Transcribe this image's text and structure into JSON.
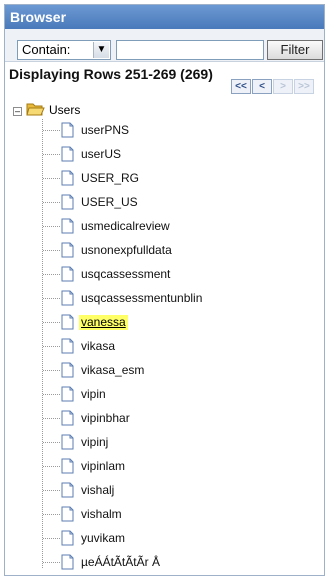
{
  "header": {
    "title": "Browser"
  },
  "toolbar": {
    "select_value": "Contain:",
    "text_value": "",
    "filter_label": "Filter"
  },
  "status": {
    "text": "Displaying Rows 251-269 (269)"
  },
  "pager": {
    "first": "<<",
    "prev": "<",
    "next": ">",
    "last": ">>"
  },
  "tree": {
    "root_label": "Users",
    "items": [
      {
        "label": "userPNS",
        "selected": false
      },
      {
        "label": "userUS",
        "selected": false
      },
      {
        "label": "USER_RG",
        "selected": false
      },
      {
        "label": "USER_US",
        "selected": false
      },
      {
        "label": "usmedicalreview",
        "selected": false
      },
      {
        "label": "usnonexpfulldata",
        "selected": false
      },
      {
        "label": "usqcassessment",
        "selected": false
      },
      {
        "label": "usqcassessmentunblin",
        "selected": false
      },
      {
        "label": "vanessa",
        "selected": true
      },
      {
        "label": "vikasa",
        "selected": false
      },
      {
        "label": "vikasa_esm",
        "selected": false
      },
      {
        "label": "vipin",
        "selected": false
      },
      {
        "label": "vipinbhar",
        "selected": false
      },
      {
        "label": "vipinj",
        "selected": false
      },
      {
        "label": "vipinlam",
        "selected": false
      },
      {
        "label": "vishalj",
        "selected": false
      },
      {
        "label": "vishalm",
        "selected": false
      },
      {
        "label": "yuvikam",
        "selected": false
      },
      {
        "label": "µeÁÁtÃtÃtÃr Å",
        "selected": false
      }
    ]
  },
  "colors": {
    "header_bg": "#4f7fc0",
    "highlight": "#ffff66"
  }
}
